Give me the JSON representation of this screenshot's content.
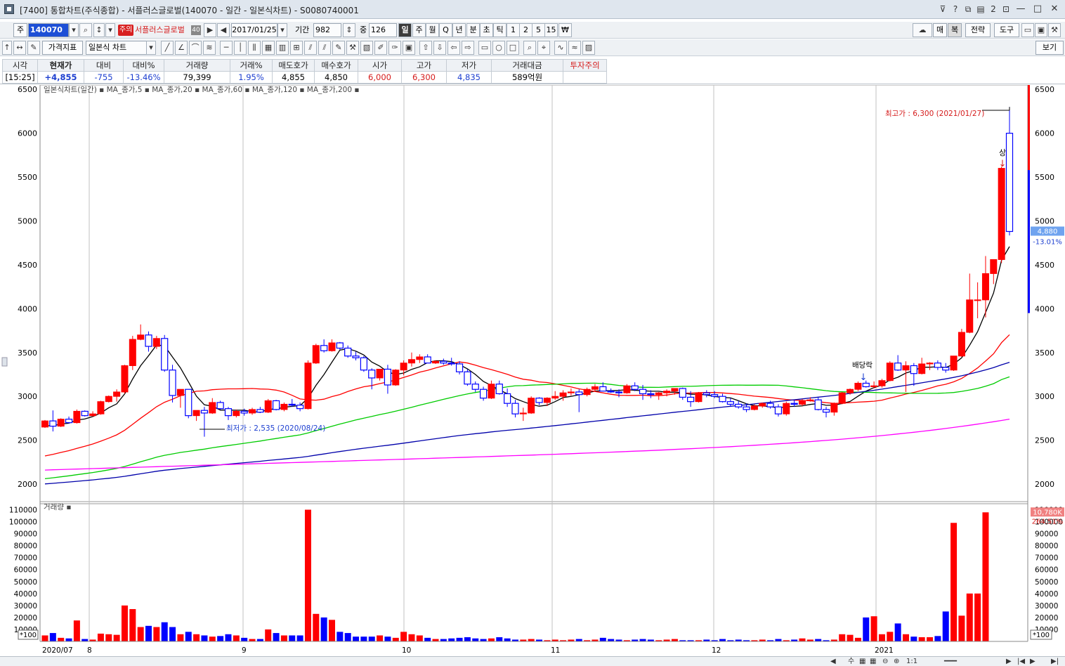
{
  "titlebar": {
    "title": "[7400] 통합차트(주식종합) - 서플러스글로벌(140070 - 일간 - 일본식차트) - S0080740001",
    "icons": [
      "pin-icon",
      "help-icon",
      "restore-icon",
      "window-list-icon",
      "num-2-label",
      "tray-icon"
    ],
    "labels": {
      "help": "?",
      "two": "2"
    }
  },
  "toolbar1": {
    "market": "주",
    "code": "140070",
    "warn_badge": "주의",
    "stock_name": "서플러스글로벌",
    "nav_badge": "40",
    "date": "2017/01/25",
    "period_label": "기간",
    "period_value": "982",
    "center_label": "중",
    "center_value": "126",
    "periods": [
      "일",
      "주",
      "월",
      "Q",
      "년",
      "분",
      "초",
      "틱",
      "1",
      "2",
      "5",
      "15",
      "₩"
    ],
    "active_period": "일",
    "right_buttons": [
      "매",
      "복",
      "전략",
      "도구"
    ]
  },
  "toolbar2": {
    "indicator_label": "가격지표",
    "chart_type": "일본식 차트",
    "view_label": "보기"
  },
  "quote": {
    "headers": [
      "시각",
      "현재가",
      "대비",
      "대비%",
      "거래량",
      "거래%",
      "매도호가",
      "매수호가",
      "시가",
      "고가",
      "저가",
      "거래대금",
      "투자주의"
    ],
    "values": [
      "[15:25]",
      "+4,855",
      "-755",
      "-13.46%",
      "79,399",
      "1.95%",
      "4,855",
      "4,850",
      "6,000",
      "6,300",
      "4,835",
      "589억원",
      ""
    ]
  },
  "colors": {
    "up": "#ff0000",
    "down": "#0000ff",
    "ma5": "#000000",
    "ma20": "#ff0000",
    "ma60": "#00cc00",
    "ma120": "#0000aa",
    "ma200": "#ff00ff"
  },
  "chart_data": {
    "type": "candlestick",
    "legend": "일본식차트(일간) ▪ MA_종가,5 ▪ MA_종가,20 ▪ MA_종가,60 ▪ MA_종가,120 ▪ MA_종가,200 ▪",
    "legend_items": [
      "일본식차트(일간)",
      "MA_종가,5",
      "MA_종가,20",
      "MA_종가,60",
      "MA_종가,120",
      "MA_종가,200"
    ],
    "price_axis": {
      "min": 1800,
      "max": 6550,
      "ticks": [
        2000,
        2500,
        3000,
        3500,
        4000,
        4500,
        5000,
        5500,
        6000,
        6500
      ]
    },
    "x_labels": [
      "2020/07",
      "8",
      "9",
      "10",
      "11",
      "12",
      "2021"
    ],
    "annotations": {
      "high": "최고가 : 6,300 (2021/01/27)",
      "low": "최저가 : 2,535 (2020/08/24)",
      "dividend": "배당락",
      "limit_up": "상"
    },
    "current_price": {
      "value": "4,880",
      "change": "-13.01%"
    },
    "volume_axis": {
      "max": 115000,
      "ticks": [
        10000,
        20000,
        30000,
        40000,
        50000,
        60000,
        70000,
        80000,
        90000,
        100000,
        110000
      ],
      "unit": "*100"
    },
    "volume_title": "거래량 ▪",
    "volume_current": {
      "value": "10,780K",
      "change": "264.51%"
    },
    "candles": [
      [
        2650,
        2730,
        2640,
        2720
      ],
      [
        2720,
        2840,
        2600,
        2660
      ],
      [
        2660,
        2750,
        2650,
        2740
      ],
      [
        2740,
        2770,
        2690,
        2700
      ],
      [
        2700,
        2850,
        2690,
        2830
      ],
      [
        2830,
        2840,
        2770,
        2780
      ],
      [
        2780,
        2830,
        2770,
        2800
      ],
      [
        2800,
        2950,
        2790,
        2940
      ],
      [
        2940,
        3010,
        2930,
        3000
      ],
      [
        3000,
        3080,
        2940,
        3050
      ],
      [
        3050,
        3360,
        3030,
        3350
      ],
      [
        3350,
        3690,
        3300,
        3650
      ],
      [
        3650,
        3820,
        3640,
        3700
      ],
      [
        3700,
        3740,
        3510,
        3570
      ],
      [
        3570,
        3690,
        3540,
        3660
      ],
      [
        3660,
        3700,
        3280,
        3300
      ],
      [
        3300,
        3360,
        2930,
        3010
      ],
      [
        3010,
        3040,
        2870,
        3080
      ],
      [
        3080,
        3050,
        2750,
        2780
      ],
      [
        2780,
        2840,
        2720,
        2840
      ],
      [
        2840,
        2880,
        2540,
        2810
      ],
      [
        2810,
        2980,
        2800,
        2930
      ],
      [
        2930,
        2950,
        2850,
        2860
      ],
      [
        2860,
        2880,
        2730,
        2780
      ],
      [
        2780,
        2850,
        2760,
        2830
      ],
      [
        2830,
        2860,
        2780,
        2810
      ],
      [
        2810,
        2870,
        2790,
        2850
      ],
      [
        2850,
        2880,
        2810,
        2820
      ],
      [
        2820,
        2970,
        2810,
        2950
      ],
      [
        2950,
        2960,
        2840,
        2850
      ],
      [
        2850,
        2930,
        2830,
        2910
      ],
      [
        2910,
        2970,
        2880,
        2900
      ],
      [
        2900,
        2930,
        2830,
        2860
      ],
      [
        2860,
        3410,
        2850,
        3380
      ],
      [
        3380,
        3600,
        3370,
        3580
      ],
      [
        3580,
        3650,
        3500,
        3520
      ],
      [
        3520,
        3650,
        3510,
        3610
      ],
      [
        3610,
        3620,
        3530,
        3550
      ],
      [
        3550,
        3580,
        3440,
        3460
      ],
      [
        3460,
        3510,
        3410,
        3440
      ],
      [
        3440,
        3460,
        3280,
        3300
      ],
      [
        3300,
        3320,
        3080,
        3210
      ],
      [
        3210,
        3300,
        3180,
        3310
      ],
      [
        3310,
        3360,
        3030,
        3130
      ],
      [
        3130,
        3310,
        3120,
        3300
      ],
      [
        3300,
        3410,
        3240,
        3380
      ],
      [
        3380,
        3500,
        3340,
        3420
      ],
      [
        3420,
        3480,
        3380,
        3450
      ],
      [
        3450,
        3480,
        3390,
        3380
      ],
      [
        3380,
        3410,
        3370,
        3400
      ],
      [
        3400,
        3430,
        3360,
        3380
      ],
      [
        3380,
        3440,
        3350,
        3370
      ],
      [
        3370,
        3400,
        3250,
        3280
      ],
      [
        3280,
        3310,
        3120,
        3140
      ],
      [
        3140,
        3170,
        3050,
        3080
      ],
      [
        3080,
        3110,
        2950,
        2980
      ],
      [
        2980,
        3180,
        2970,
        3140
      ],
      [
        3140,
        3180,
        3020,
        3030
      ],
      [
        3030,
        3090,
        2880,
        2920
      ],
      [
        2920,
        2960,
        2760,
        2800
      ],
      [
        2800,
        2870,
        2720,
        2810
      ],
      [
        2810,
        3000,
        2800,
        2980
      ],
      [
        2980,
        2990,
        2900,
        2930
      ],
      [
        2930,
        2990,
        2890,
        2980
      ],
      [
        2980,
        3060,
        2960,
        3000
      ],
      [
        3000,
        3070,
        2950,
        3040
      ],
      [
        3040,
        3090,
        3010,
        3050
      ],
      [
        3050,
        3080,
        2820,
        3020
      ],
      [
        3020,
        3100,
        3000,
        3080
      ],
      [
        3080,
        3140,
        3060,
        3110
      ],
      [
        3110,
        3160,
        3070,
        3060
      ],
      [
        3060,
        3090,
        3040,
        3050
      ],
      [
        3050,
        3080,
        2990,
        3040
      ],
      [
        3040,
        3140,
        3030,
        3120
      ],
      [
        3120,
        3160,
        3060,
        3080
      ],
      [
        3080,
        3130,
        2960,
        3030
      ],
      [
        3030,
        3070,
        2980,
        3020
      ],
      [
        3020,
        3050,
        2960,
        3040
      ],
      [
        3040,
        3080,
        3000,
        3060
      ],
      [
        3060,
        3090,
        3020,
        3090
      ],
      [
        3090,
        3100,
        2960,
        2990
      ],
      [
        2990,
        3060,
        2880,
        2940
      ],
      [
        2940,
        3050,
        2930,
        3040
      ],
      [
        3040,
        3070,
        2990,
        3020
      ],
      [
        3020,
        3060,
        2980,
        3000
      ],
      [
        3000,
        3030,
        2930,
        2940
      ],
      [
        2940,
        2980,
        2880,
        2910
      ],
      [
        2910,
        2950,
        2860,
        2880
      ],
      [
        2880,
        2920,
        2820,
        2850
      ],
      [
        2850,
        2910,
        2840,
        2890
      ],
      [
        2890,
        2930,
        2870,
        2920
      ],
      [
        2920,
        2950,
        2860,
        2880
      ],
      [
        2880,
        2910,
        2770,
        2800
      ],
      [
        2800,
        2940,
        2780,
        2920
      ],
      [
        2920,
        2960,
        2880,
        2910
      ],
      [
        2910,
        2970,
        2890,
        2950
      ],
      [
        2950,
        2990,
        2940,
        2960
      ],
      [
        2960,
        2990,
        2840,
        2850
      ],
      [
        2850,
        2880,
        2760,
        2820
      ],
      [
        2820,
        2930,
        2780,
        2920
      ],
      [
        2920,
        3050,
        2910,
        3040
      ],
      [
        3040,
        3090,
        3020,
        3080
      ],
      [
        3080,
        3170,
        3060,
        3150
      ],
      [
        3150,
        3180,
        3100,
        3110
      ],
      [
        3110,
        3170,
        3090,
        3120
      ],
      [
        3120,
        3200,
        3100,
        3180
      ],
      [
        3180,
        3400,
        3170,
        3380
      ],
      [
        3380,
        3470,
        3290,
        3300
      ],
      [
        3300,
        3400,
        3050,
        3350
      ],
      [
        3350,
        3380,
        3120,
        3260
      ],
      [
        3260,
        3440,
        3250,
        3370
      ],
      [
        3370,
        3390,
        3300,
        3380
      ],
      [
        3380,
        3410,
        3300,
        3330
      ],
      [
        3330,
        3380,
        3270,
        3300
      ],
      [
        3300,
        3460,
        3290,
        3460
      ],
      [
        3460,
        3770,
        3450,
        3730
      ],
      [
        3730,
        4400,
        3720,
        4100
      ],
      [
        4100,
        4300,
        3890,
        4100
      ],
      [
        4100,
        4600,
        3900,
        4400
      ],
      [
        4400,
        4400,
        4280,
        4560
      ],
      [
        4560,
        5620,
        4520,
        5600
      ],
      [
        6000,
        6300,
        4835,
        4880
      ]
    ],
    "volumes": [
      5000,
      7000,
      3000,
      2500,
      17500,
      2000,
      1500,
      6500,
      6000,
      5500,
      30000,
      27000,
      12000,
      13000,
      12000,
      16000,
      12000,
      6000,
      8000,
      6000,
      5000,
      4000,
      4500,
      6000,
      5000,
      3000,
      2000,
      2000,
      10000,
      7000,
      5000,
      5000,
      5000,
      110000,
      23000,
      20000,
      18000,
      8000,
      7000,
      4000,
      4000,
      4000,
      5000,
      4000,
      3000,
      8000,
      6000,
      5000,
      3000,
      2000,
      2000,
      2500,
      3000,
      3500,
      2500,
      2000,
      2500,
      3500,
      2500,
      1500,
      1500,
      2000,
      1500,
      1000,
      1500,
      1000,
      1500,
      2000,
      1000,
      1500,
      3000,
      2000,
      1500,
      1000,
      1500,
      2000,
      1500,
      1000,
      1500,
      2000,
      1000,
      1000,
      1000,
      1500,
      1000,
      2000,
      1000,
      1500,
      1000,
      1000,
      1500,
      1000,
      2000,
      1000,
      1500,
      2500,
      1500,
      2000,
      1000,
      1500,
      6000,
      5500,
      3000,
      20000,
      21000,
      6000,
      8000,
      15000,
      6000,
      4000,
      3500,
      3500,
      4500,
      25000,
      99000,
      21500,
      40000,
      40000,
      107800
    ]
  },
  "statusbar": {
    "right_items": [
      "◀",
      "수",
      "▦",
      "▦",
      "⊖",
      "⊕",
      "1:1",
      "━━━",
      "▶",
      "|◀",
      "▶",
      "▶|"
    ],
    "ratio": "1:1"
  }
}
